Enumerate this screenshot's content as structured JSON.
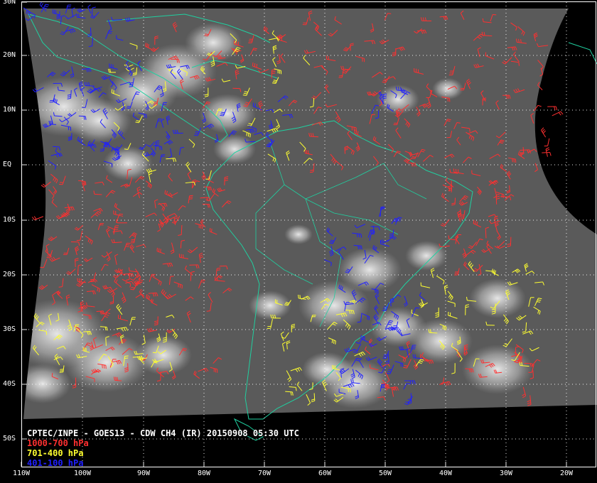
{
  "title": "CPTEC/INPE - GOES13 - CDW CH4 (IR) 20150908 05:30 UTC",
  "legend": [
    {
      "label": "1000-700 hPa",
      "color": "#ff3030"
    },
    {
      "label": "701-400 hPa",
      "color": "#ffff30"
    },
    {
      "label": "401-100 hPa",
      "color": "#2020ff"
    }
  ],
  "colors": {
    "background": "#000000",
    "coastline": "#20d0a0",
    "grid": "#ffffff",
    "frame": "#ffffff"
  },
  "lat_labels": [
    "30N",
    "20N",
    "10N",
    "EQ",
    "10S",
    "20S",
    "30S",
    "40S",
    "50S"
  ],
  "lon_labels": [
    "110W",
    "100W",
    "90W",
    "80W",
    "70W",
    "60W",
    "50W",
    "40W",
    "30W",
    "20W"
  ]
}
